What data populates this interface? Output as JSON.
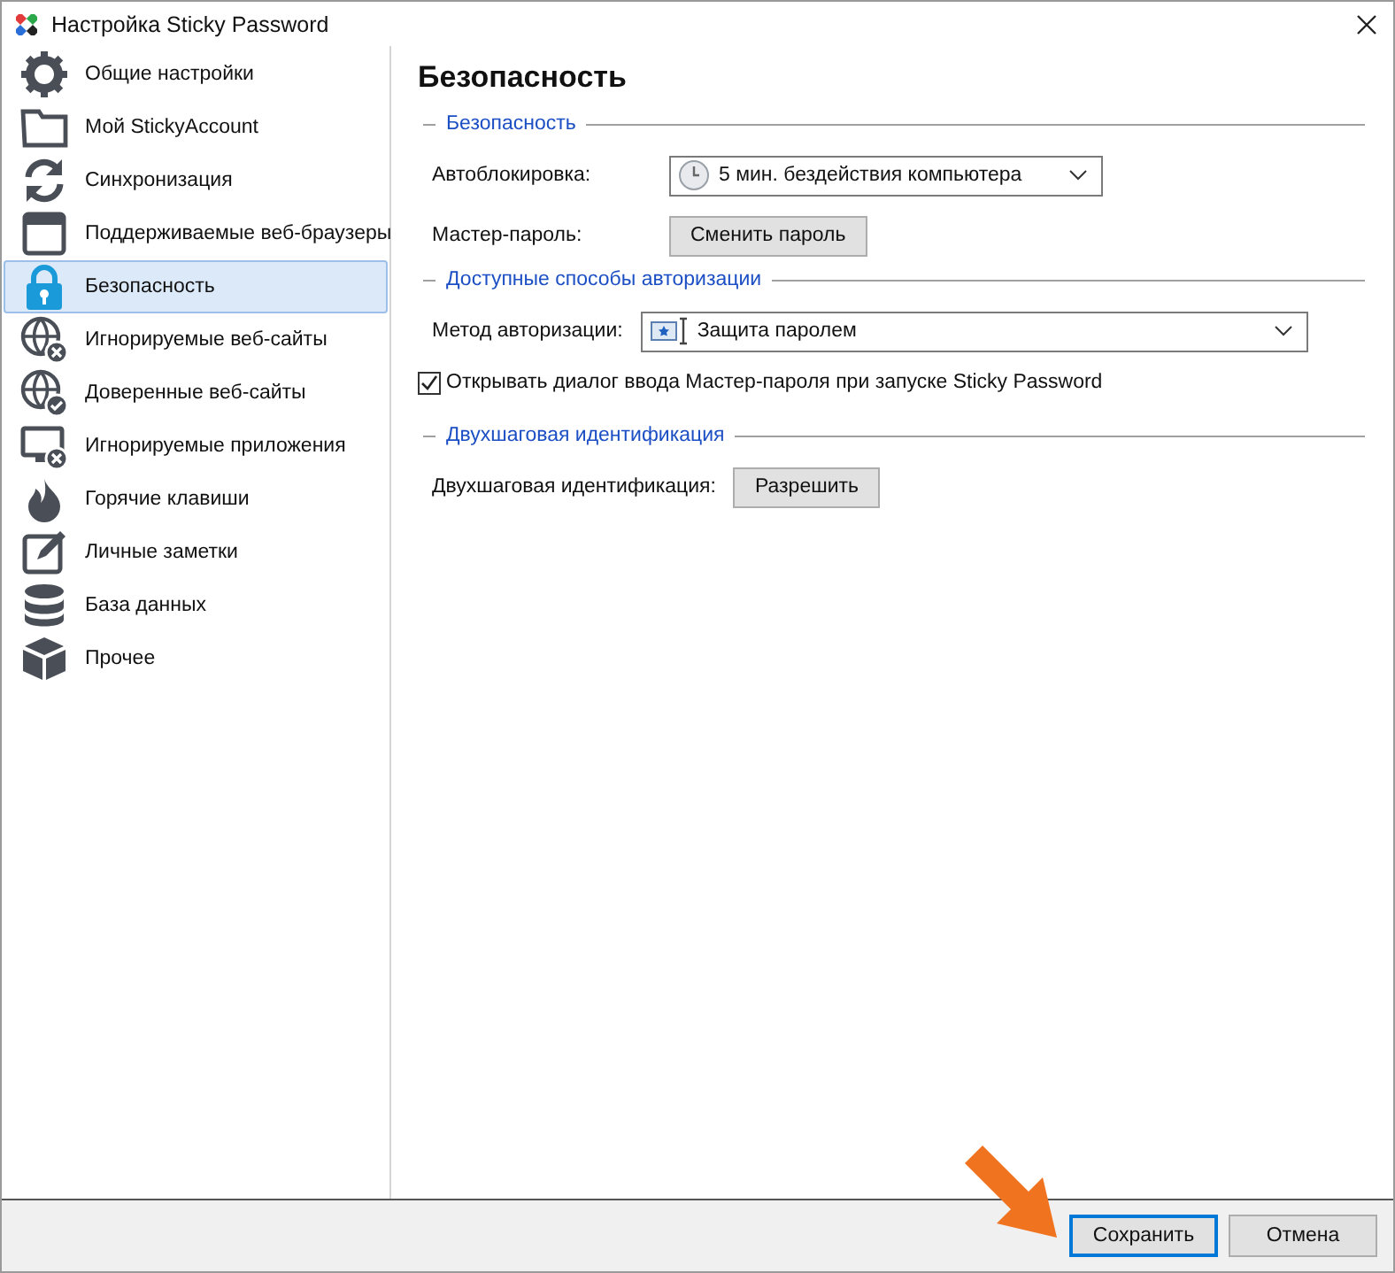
{
  "window": {
    "title": "Настройка Sticky Password"
  },
  "sidebar": {
    "items": [
      {
        "label": "Общие настройки",
        "selected": false
      },
      {
        "label": "Мой StickyAccount",
        "selected": false
      },
      {
        "label": "Синхронизация",
        "selected": false
      },
      {
        "label": "Поддерживаемые веб-браузеры",
        "selected": false
      },
      {
        "label": "Безопасность",
        "selected": true
      },
      {
        "label": "Игнорируемые веб-сайты",
        "selected": false
      },
      {
        "label": "Доверенные веб-сайты",
        "selected": false
      },
      {
        "label": "Игнорируемые приложения",
        "selected": false
      },
      {
        "label": "Горячие клавиши",
        "selected": false
      },
      {
        "label": "Личные заметки",
        "selected": false
      },
      {
        "label": "База данных",
        "selected": false
      },
      {
        "label": "Прочее",
        "selected": false
      }
    ]
  },
  "content": {
    "title": "Безопасность",
    "sections": [
      {
        "title": "Безопасность",
        "rows": [
          {
            "kind": "select",
            "label": "Автоблокировка:",
            "value": "5 мин. бездействия компьютера"
          },
          {
            "kind": "button",
            "label": "Мастер-пароль:",
            "button": "Сменить пароль"
          }
        ]
      },
      {
        "title": "Доступные способы авторизации",
        "rows": [
          {
            "kind": "select",
            "label": "Метод авторизации:",
            "value": "Защита паролем"
          },
          {
            "kind": "checkbox",
            "label": "Открывать диалог ввода Мастер-пароля при запуске Sticky Password",
            "checked": true
          }
        ]
      },
      {
        "title": "Двухшаговая идентификация",
        "rows": [
          {
            "kind": "button",
            "label": "Двухшаговая идентификация:",
            "button": "Разрешить"
          }
        ]
      }
    ]
  },
  "buttons": [
    {
      "label": "Сохранить",
      "default": true
    },
    {
      "label": "Отмена",
      "default": false
    }
  ]
}
